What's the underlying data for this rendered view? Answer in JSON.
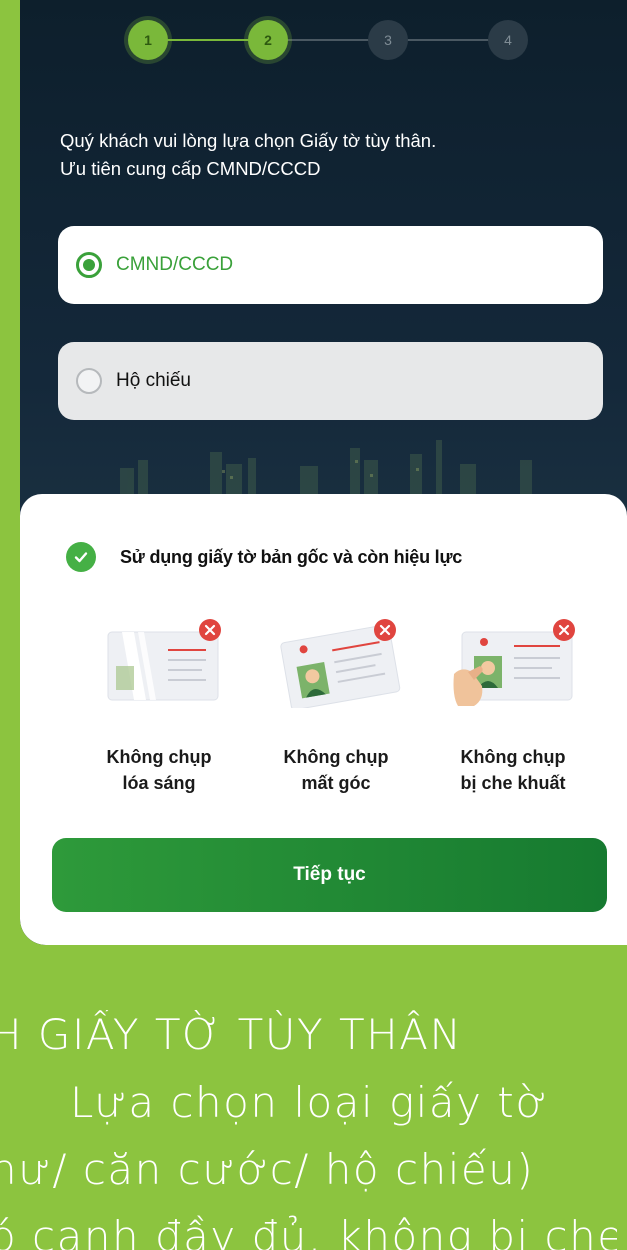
{
  "stepper": {
    "steps": [
      {
        "label": "1",
        "state": "done"
      },
      {
        "label": "2",
        "state": "done"
      },
      {
        "label": "3",
        "state": "todo"
      },
      {
        "label": "4",
        "state": "todo"
      }
    ]
  },
  "instruction": {
    "line1": "Quý khách vui lòng lựa chọn Giấy tờ tùy thân.",
    "line2": "Ưu tiên cung cấp CMND/CCCD"
  },
  "options": {
    "id_card": {
      "label": "CMND/CCCD",
      "selected": true
    },
    "passport": {
      "label": "Hộ chiếu",
      "selected": false
    }
  },
  "sheet": {
    "tip": "Sử dụng giấy tờ bản gốc và còn hiệu lực",
    "examples": [
      {
        "line1": "Không chụp",
        "line2": "lóa sáng",
        "icon": "glare-card-icon"
      },
      {
        "line1": "Không chụp",
        "line2": "mất góc",
        "icon": "cut-corner-card-icon"
      },
      {
        "line1": "Không chụp",
        "line2": "bị che khuất",
        "icon": "covered-card-icon"
      }
    ],
    "continue_label": "Tiếp tục"
  },
  "caption": {
    "line1": "H GIẤY TỜ TÙY THÂN",
    "line2": "Lựa chọn loại giấy tờ",
    "line3": "hư/ căn cước/ hộ chiếu)",
    "line4": "ó cạnh đầy đủ, không bị che"
  },
  "colors": {
    "brand_green": "#3aa13a",
    "page_background": "#8cc43f",
    "error_red": "#e0453f"
  }
}
